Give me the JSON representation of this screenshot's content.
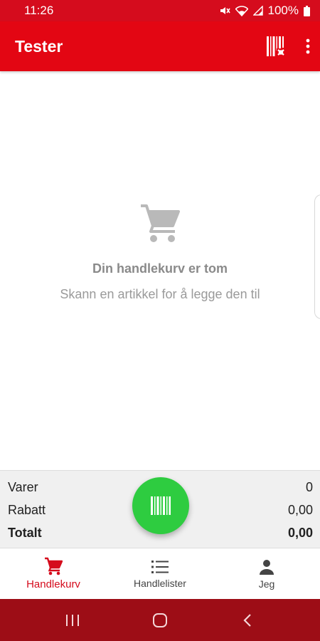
{
  "status_bar": {
    "time": "11:26",
    "battery": "100%",
    "icons": [
      "mute-icon",
      "wifi-icon",
      "signal-icon",
      "battery-icon"
    ]
  },
  "app_bar": {
    "title": "Tester",
    "actions": [
      "barcode-scan-icon",
      "more-vert-icon"
    ],
    "background": "#e30613"
  },
  "empty_state": {
    "icon": "shopping-cart-icon",
    "title": "Din handlekurv er tom",
    "subtitle": "Skann en artikkel for å legge den til"
  },
  "summary": {
    "rows": [
      {
        "label": "Varer",
        "value": "0"
      },
      {
        "label": "Rabatt",
        "value": "0,00"
      },
      {
        "label": "Totalt",
        "value": "0,00"
      }
    ]
  },
  "fab": {
    "icon": "barcode-icon",
    "color": "#2ecc40"
  },
  "bottom_nav": {
    "items": [
      {
        "label": "Handlekurv",
        "icon": "shopping-cart-icon",
        "active": true
      },
      {
        "label": "Handlelister",
        "icon": "list-icon",
        "active": false
      },
      {
        "label": "Jeg",
        "icon": "person-icon",
        "active": false
      }
    ],
    "active_color": "#d50c1d"
  },
  "system_nav": {
    "buttons": [
      "recents-icon",
      "home-icon",
      "back-icon"
    ],
    "background": "#9d0d16"
  }
}
